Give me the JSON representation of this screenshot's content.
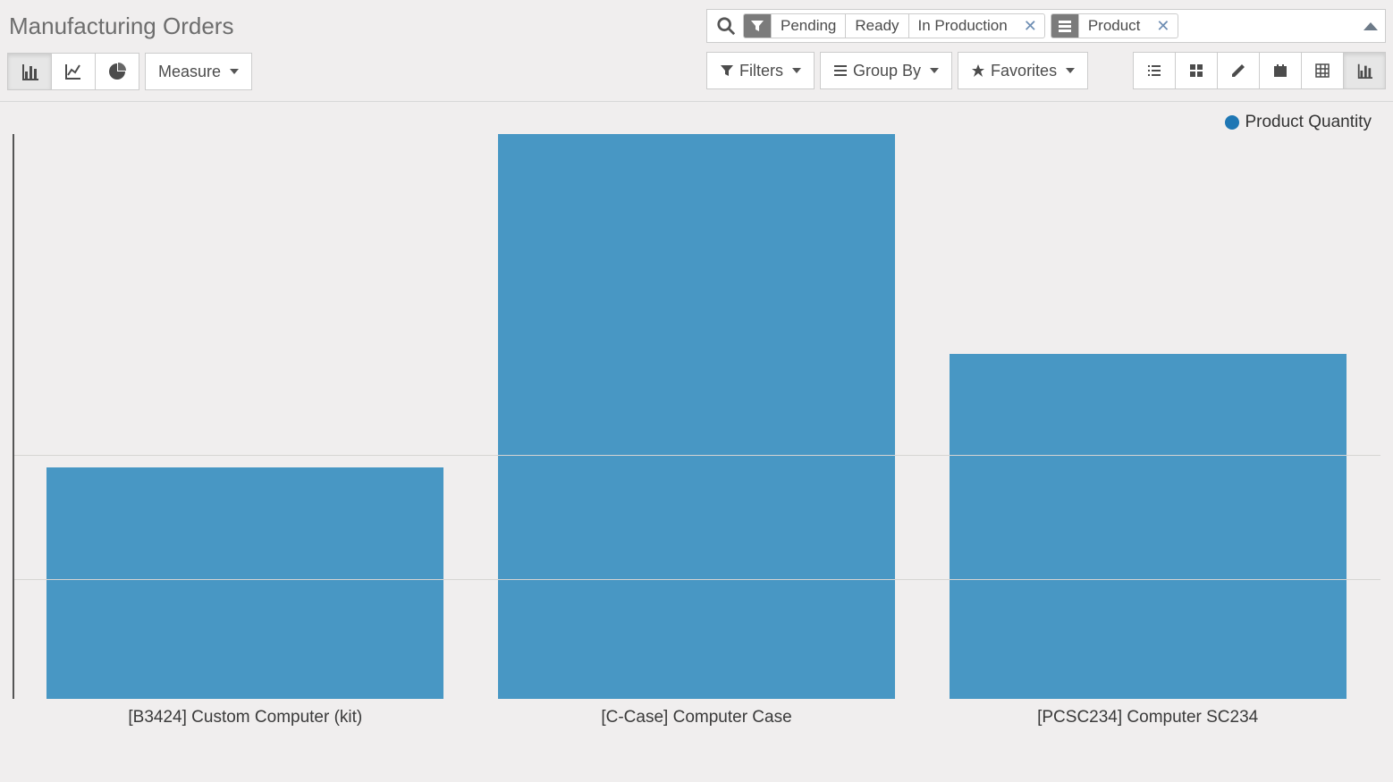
{
  "page_title": "Manufacturing Orders",
  "chart_controls": {
    "measure_label": "Measure"
  },
  "search": {
    "facets": [
      {
        "icon": "filter",
        "values": [
          "Pending",
          "Ready",
          "In Production"
        ],
        "removable": true
      },
      {
        "icon": "groupby",
        "values": [
          "Product"
        ],
        "removable": true
      }
    ]
  },
  "filter_buttons": {
    "filters_label": "Filters",
    "groupby_label": "Group By",
    "favorites_label": "Favorites"
  },
  "legend_label": "Product Quantity",
  "colors": {
    "bar": "#4897c4",
    "legend_dot": "#1f77b4"
  },
  "chart_data": {
    "type": "bar",
    "title": "",
    "xlabel": "",
    "ylabel": "",
    "ylim": [
      0,
      100
    ],
    "categories": [
      "[B3424] Custom Computer (kit)",
      "[C-Case] Computer Case",
      "[PCSC234] Computer SC234"
    ],
    "series": [
      {
        "name": "Product Quantity",
        "values": [
          41,
          100,
          61
        ]
      }
    ],
    "gridlines_y": [
      21,
      43
    ]
  }
}
